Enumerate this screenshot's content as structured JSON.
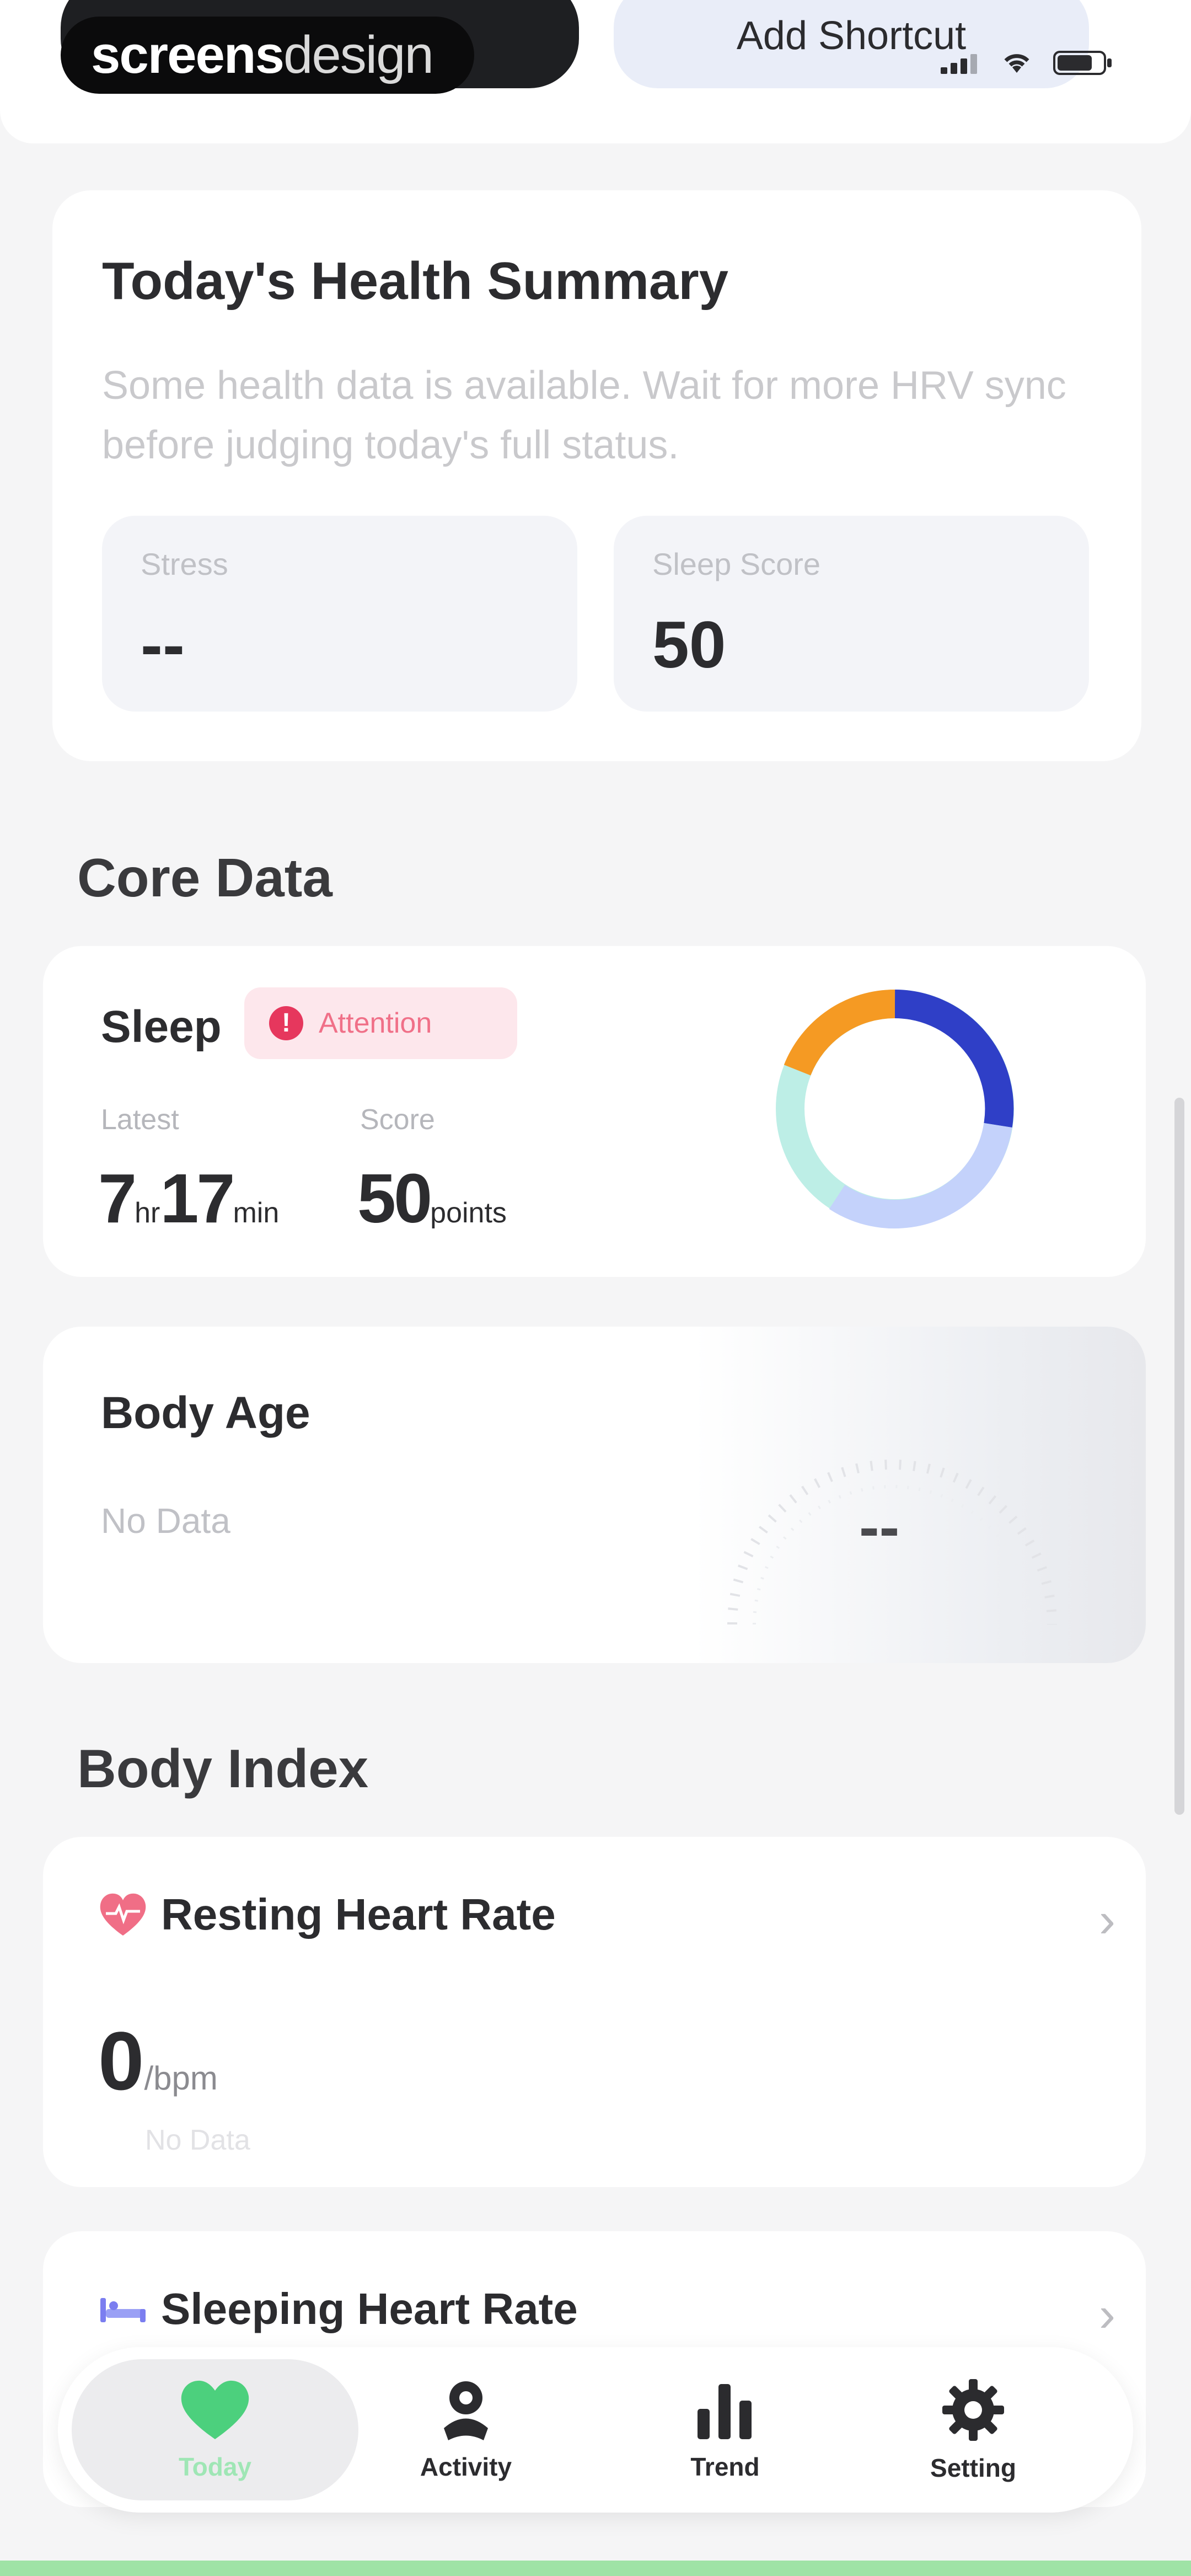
{
  "top": {
    "brand_bold": "screens",
    "brand_light": "design",
    "add_shortcut_label": "Add Shortcut"
  },
  "summary": {
    "title": "Today's Health Summary",
    "description": "Some health data is available. Wait for more HRV sync before judging today's full status.",
    "stress_label": "Stress",
    "stress_value": "--",
    "sleep_score_label": "Sleep Score",
    "sleep_score_value": "50"
  },
  "core_data": {
    "title": "Core Data",
    "sleep": {
      "title": "Sleep",
      "badge": "Attention",
      "latest_label": "Latest",
      "latest_hours": "7",
      "latest_hours_unit": "hr",
      "latest_minutes": "17",
      "latest_minutes_unit": "min",
      "score_label": "Score",
      "score_value": "50",
      "score_unit": "points"
    },
    "body_age": {
      "title": "Body Age",
      "status": "No Data",
      "value": "--"
    }
  },
  "body_index": {
    "title": "Body Index",
    "resting_hr": {
      "title": "Resting Heart Rate",
      "value": "0",
      "unit": "/bpm",
      "status": "No Data"
    },
    "sleeping_hr": {
      "title": "Sleeping Heart Rate"
    }
  },
  "nav": {
    "today": "Today",
    "activity": "Activity",
    "trend": "Trend",
    "setting": "Setting"
  },
  "colors": {
    "accent_green": "#4cd07d",
    "attention_red": "#e6375d",
    "donut_blue": "#2f3fc7",
    "donut_light_blue": "#c4d2fb",
    "donut_teal": "#bdeee6",
    "donut_orange": "#f59a23"
  }
}
